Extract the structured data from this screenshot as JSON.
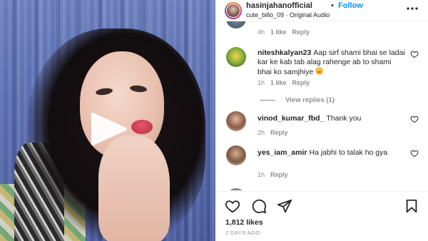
{
  "header": {
    "username": "hasinjahanofficial",
    "separator": "•",
    "follow_label": "Follow",
    "subtitle": "cute_billo_09 · Original Audio"
  },
  "comments": [
    {
      "username": "",
      "text": "",
      "time": "4h",
      "likes": "1 like",
      "reply": "Reply"
    },
    {
      "username": "niteshkalyan23",
      "text": "Aap sirf shami bhai se ladai kar ke kab tab alag rahenge ab to shami bhai ko samjhiye",
      "emoji": "smiling-face-emoji",
      "time": "1h",
      "likes": "1 like",
      "reply": "Reply",
      "view_replies": "View replies (1)"
    },
    {
      "username": "vinod_kumar_fbd_",
      "text": "Thank you",
      "time": "2h",
      "reply": "Reply"
    },
    {
      "username": "yes_iam_amir",
      "text": "Ha jabhi to talak ho gya",
      "time": "1h",
      "reply": "Reply"
    }
  ],
  "footer": {
    "likes": "1,812 likes",
    "date": "2 DAYS AGO"
  },
  "icons": {
    "like": "heart-icon",
    "comment": "comment-icon",
    "share": "share-icon",
    "save": "bookmark-icon",
    "more": "more-options-icon",
    "play": "play-icon"
  },
  "colors": {
    "follow_blue": "#0095f6",
    "muted_gray": "#8e8e8e",
    "text": "#262626"
  }
}
